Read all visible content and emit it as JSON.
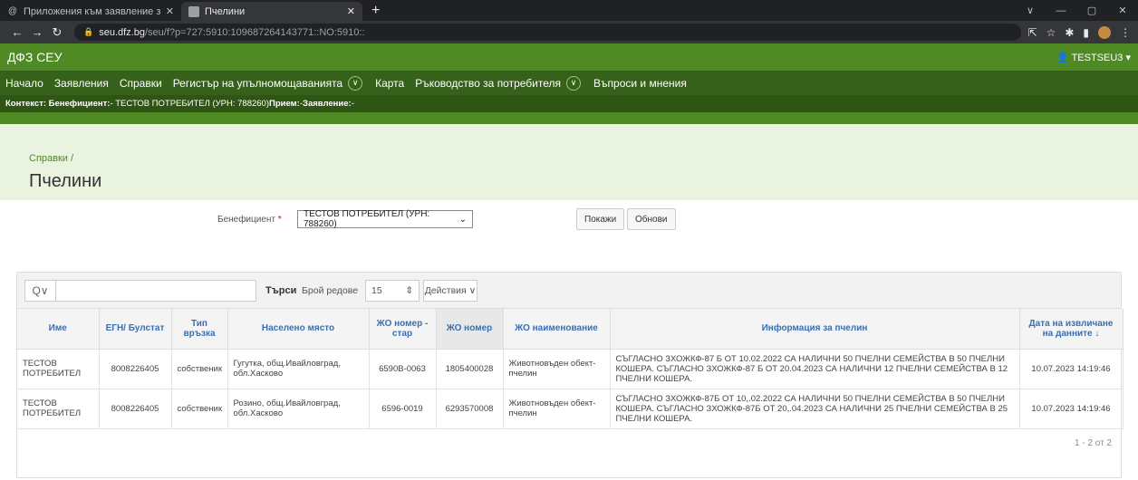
{
  "browser": {
    "tabs": [
      {
        "title": "Приложения към заявление за",
        "icon": "at-icon"
      },
      {
        "title": "Пчелини",
        "icon": "page-icon"
      }
    ],
    "url_host": "seu.dfz.bg",
    "url_path": "/seu/f?p=727:5910:109687264143771::NO:5910::"
  },
  "app": {
    "name": "ДФЗ СЕУ",
    "user": "TESTSEU3 ▾"
  },
  "menu": {
    "items": [
      "Начало",
      "Заявления",
      "Справки",
      "Регистър на упълномощаванията",
      "Карта",
      "Ръководство за потребителя",
      "Въпроси и мнения"
    ]
  },
  "context": {
    "k1": "Контекст: Бенефициент:",
    "v1": " - ТЕСТОВ ПОТРЕБИТЕЛ (УРН: 788260) ",
    "k2": "Прием:",
    "v2": " - ",
    "k3": "Заявление:",
    "v3": " -"
  },
  "page": {
    "breadcrumb": "Справки  /",
    "title": "Пчелини"
  },
  "filters": {
    "label": "Бенефициент",
    "required_mark": "*",
    "selected": "ТЕСТОВ ПОТРЕБИТЕЛ (УРН: 788260)",
    "show_button": "Покажи",
    "refresh_button": "Обнови"
  },
  "toolbar": {
    "search_icon": "Q∨",
    "go_label": "Търси",
    "rows_label": "Брой редове",
    "rows_value": "15",
    "actions_label": "Действия ∨"
  },
  "table": {
    "headers": [
      "Име",
      "ЕГН/ Булстат",
      "Тип връзка",
      "Населено място",
      "ЖО номер - стар",
      "ЖО номер",
      "ЖО наименование",
      "Информация за пчелин",
      "Дата на извличане на данните ↓"
    ],
    "rows": [
      [
        "ТЕСТОВ ПОТРЕБИТЕЛ",
        "8008226405",
        "собственик",
        "Гугутка, общ.Ивайловград, обл.Хасково",
        "6590В-0063",
        "1805400028",
        "Животновъден обект-пчелин",
        "СЪГЛАСНО ЗХОЖКФ-87 Б ОТ 10.02.2022 СА НАЛИЧНИ 50 ПЧЕЛНИ СЕМЕЙСТВА В 50 ПЧЕЛНИ КОШЕРА. СЪГЛАСНО ЗХОЖКФ-87 Б ОТ 20.04.2023 СА НАЛИЧНИ 12 ПЧЕЛНИ СЕМЕЙСТВА В 12 ПЧЕЛНИ КОШЕРА.",
        "10.07.2023 14:19:46"
      ],
      [
        "ТЕСТОВ ПОТРЕБИТЕЛ",
        "8008226405",
        "собственик",
        "Розино, общ.Ивайловград, обл.Хасково",
        "6596-0019",
        "6293570008",
        "Животновъден обект-пчелин",
        "СЪГЛАСНО ЗХОЖКФ-87Б ОТ 10,.02.2022 СА НАЛИЧНИ 50 ПЧЕЛНИ СЕМЕЙСТВА В 50 ПЧЕЛНИ КОШЕРА. СЪГЛАСНО ЗХОЖКФ-87Б ОТ 20,.04.2023 СА НАЛИЧНИ 25 ПЧЕЛНИ СЕМЕЙСТВА В 25 ПЧЕЛНИ КОШЕРА.",
        "10.07.2023 14:19:46"
      ]
    ],
    "pagination": "1 - 2 от 2"
  }
}
